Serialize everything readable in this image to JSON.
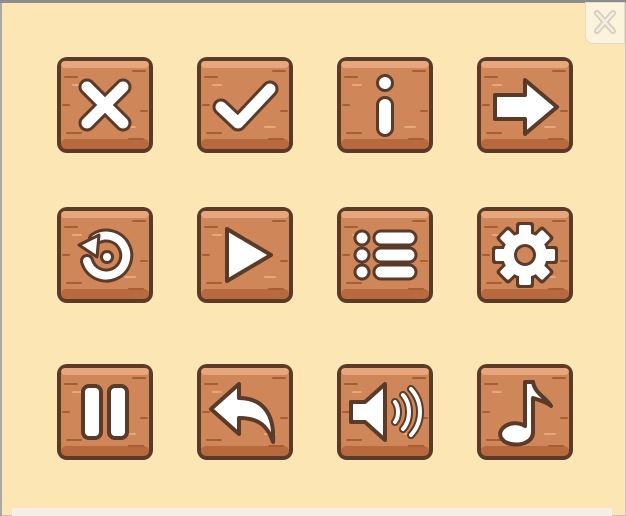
{
  "colors": {
    "background": "#fce6b3",
    "wood": "#cf8658",
    "wood_light": "#e5a77b",
    "wood_dark": "#a65f35",
    "outline": "#5a3a28",
    "glyph": "#ffffff"
  },
  "dialog": {
    "close_icon": "close-icon"
  },
  "buttons": [
    {
      "name": "close",
      "icon": "x-icon"
    },
    {
      "name": "confirm",
      "icon": "check-icon"
    },
    {
      "name": "info",
      "icon": "info-icon"
    },
    {
      "name": "next",
      "icon": "arrow-right-icon"
    },
    {
      "name": "restart",
      "icon": "restart-icon"
    },
    {
      "name": "play",
      "icon": "play-icon"
    },
    {
      "name": "menu",
      "icon": "list-icon"
    },
    {
      "name": "settings",
      "icon": "gear-icon"
    },
    {
      "name": "pause",
      "icon": "pause-icon"
    },
    {
      "name": "back",
      "icon": "return-arrow-icon"
    },
    {
      "name": "sound",
      "icon": "speaker-icon"
    },
    {
      "name": "music",
      "icon": "music-note-icon"
    }
  ]
}
